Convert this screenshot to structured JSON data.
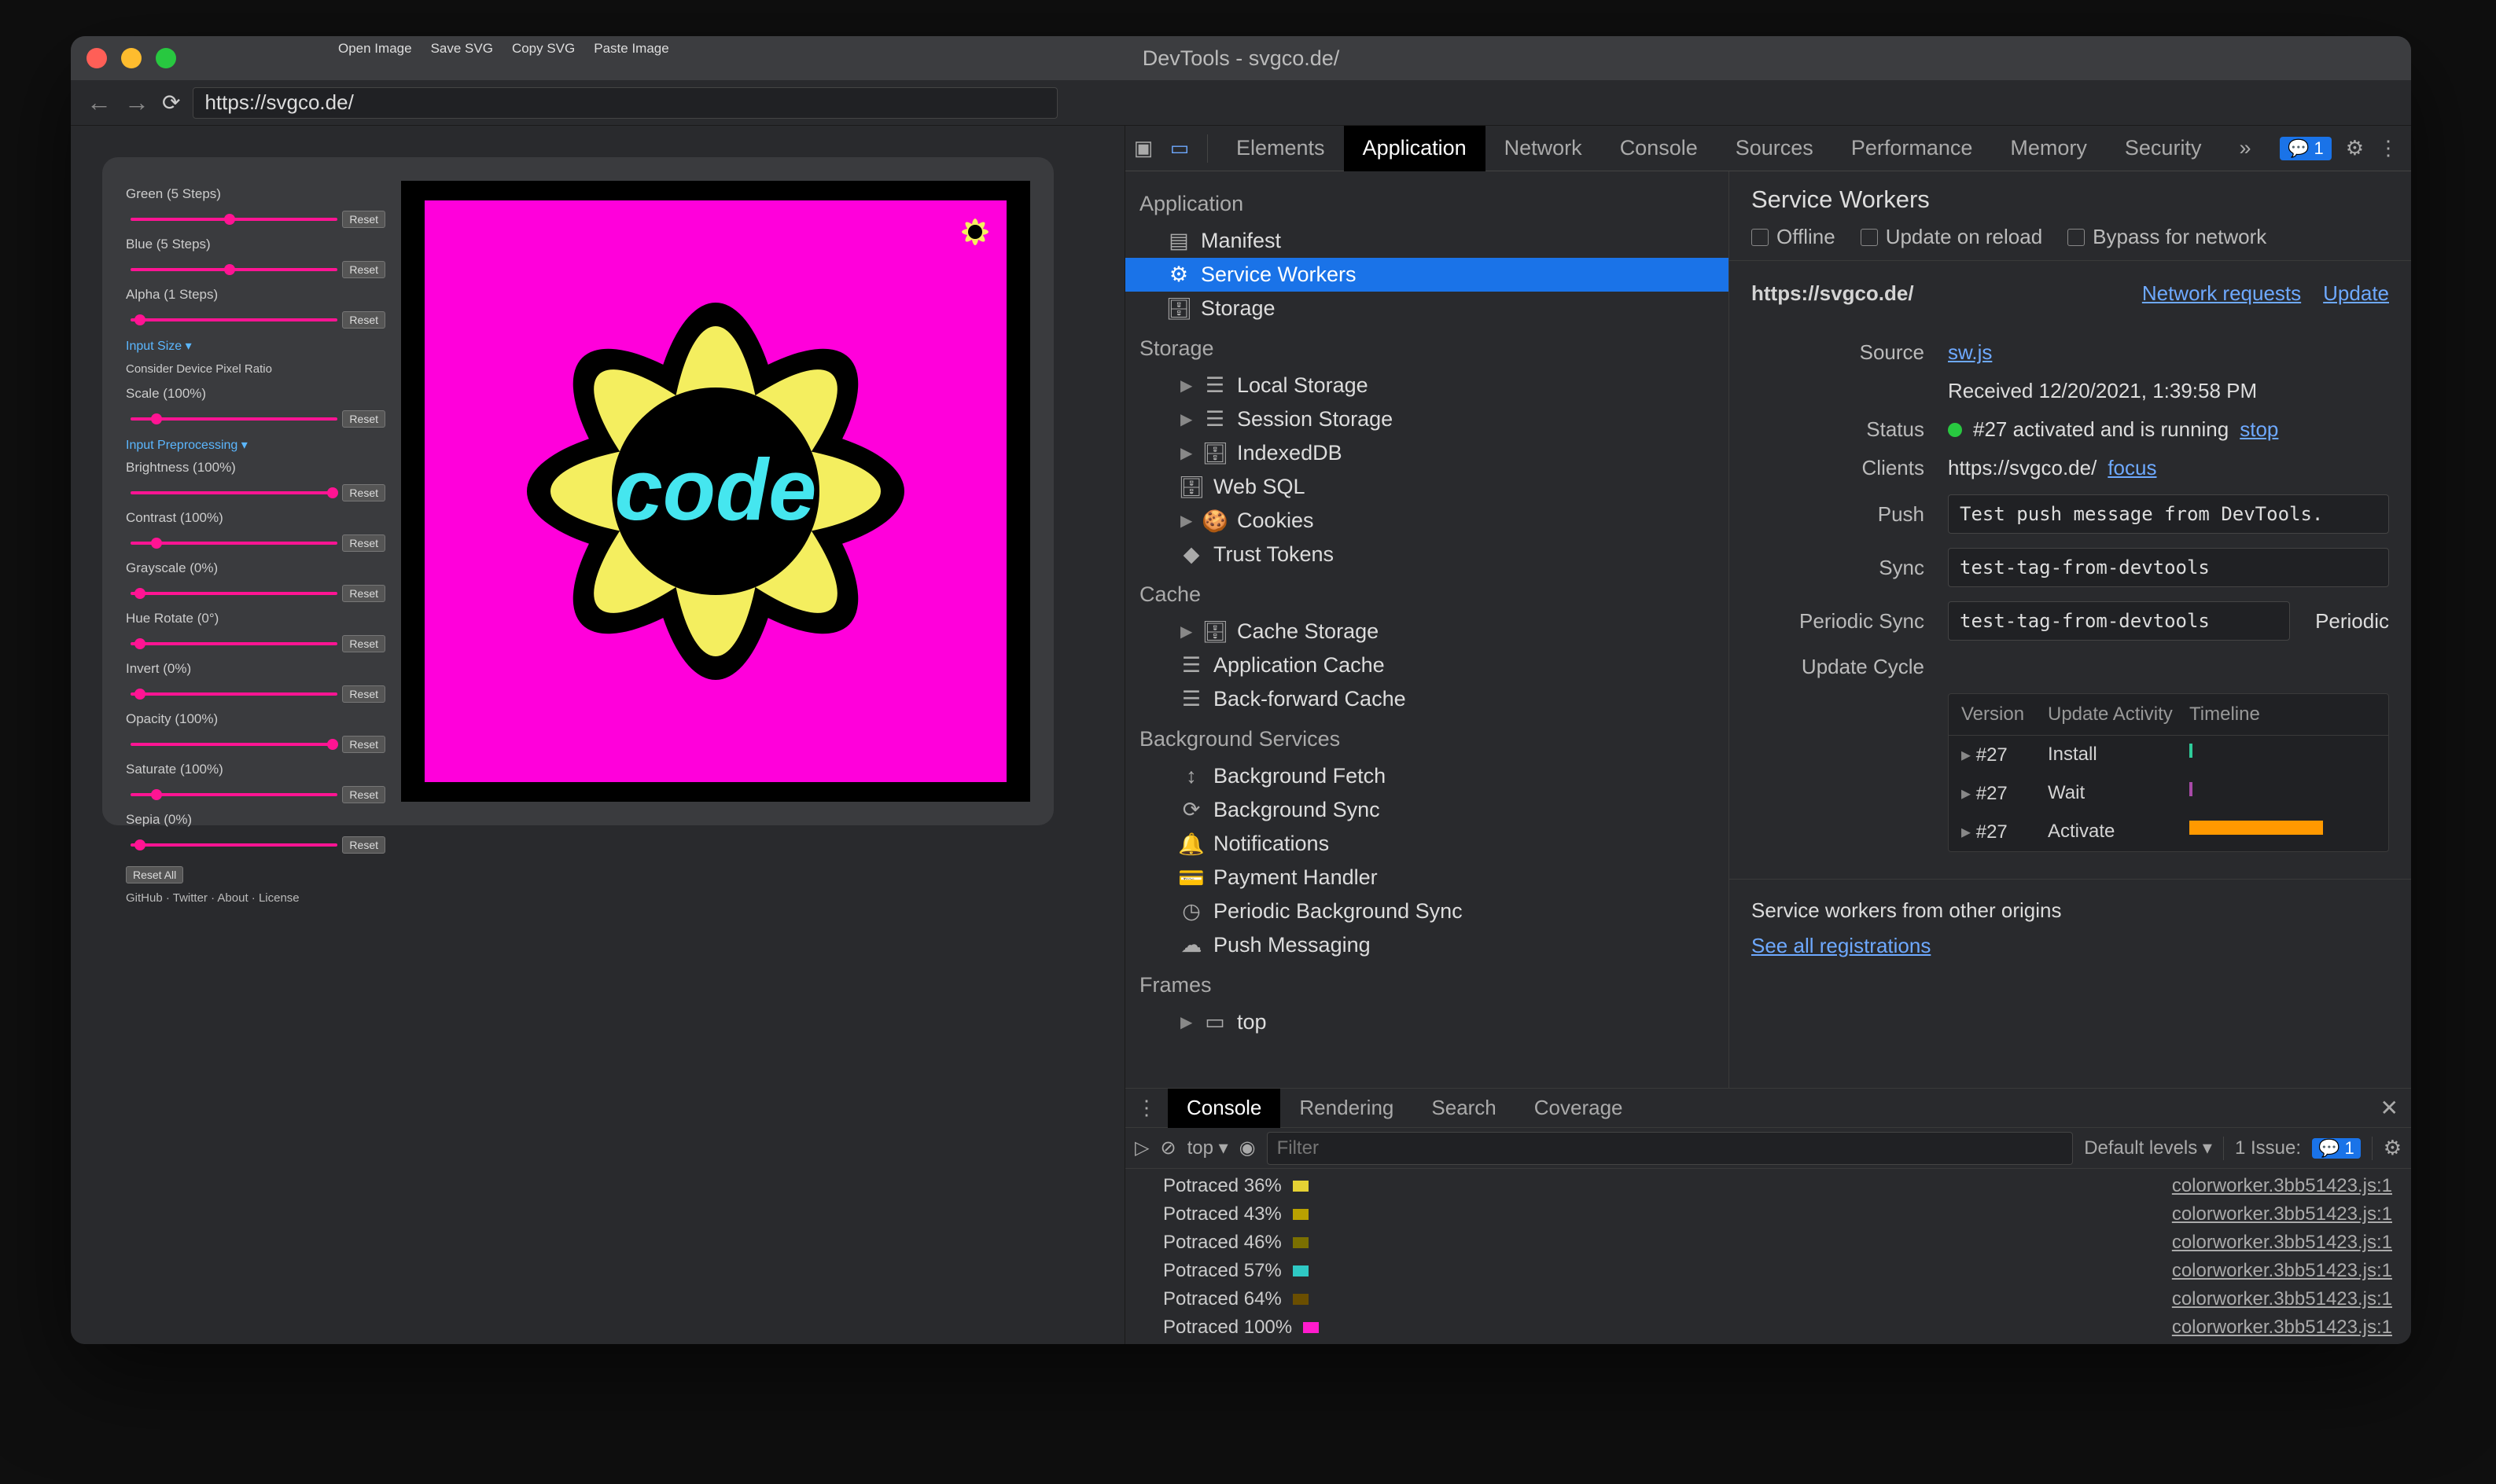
{
  "window": {
    "title": "DevTools - svgco.de/"
  },
  "browser": {
    "back": "←",
    "forward": "→",
    "reload": "⟳",
    "url": "https://svgco.de/"
  },
  "svgco": {
    "toolbar": [
      "Open Image",
      "Save SVG",
      "Copy SVG",
      "Paste Image"
    ],
    "sections": {
      "green": "Green (5 Steps)",
      "blue": "Blue (5 Steps)",
      "alpha": "Alpha (1 Steps)",
      "input_size": "Input Size ▾",
      "consider_pixel": "Consider Device Pixel Ratio",
      "scale": "Scale (100%)",
      "input_preproc": "Input Preprocessing ▾",
      "brightness": "Brightness (100%)",
      "contrast": "Contrast (100%)",
      "grayscale": "Grayscale (0%)",
      "hue": "Hue Rotate (0°)",
      "invert": "Invert (0%)",
      "opacity": "Opacity (100%)",
      "saturate": "Saturate (100%)",
      "sepia": "Sepia (0%)"
    },
    "reset": "Reset",
    "reset_all": "Reset All",
    "footer": "GitHub · Twitter · About · License"
  },
  "devtools": {
    "tabs": [
      "Elements",
      "Application",
      "Network",
      "Console",
      "Sources",
      "Performance",
      "Memory",
      "Security"
    ],
    "more": "»",
    "issues": "1",
    "tree": {
      "application": "Application",
      "manifest": "Manifest",
      "service_workers": "Service Workers",
      "storage_icon_label": "Storage",
      "storage": "Storage",
      "local_storage": "Local Storage",
      "session_storage": "Session Storage",
      "indexeddb": "IndexedDB",
      "web_sql": "Web SQL",
      "cookies": "Cookies",
      "trust_tokens": "Trust Tokens",
      "cache": "Cache",
      "cache_storage": "Cache Storage",
      "application_cache": "Application Cache",
      "bfcache": "Back-forward Cache",
      "bg_services": "Background Services",
      "bg_fetch": "Background Fetch",
      "bg_sync": "Background Sync",
      "notifications": "Notifications",
      "payment": "Payment Handler",
      "periodic_bg_sync": "Periodic Background Sync",
      "push": "Push Messaging",
      "frames": "Frames",
      "top": "top"
    },
    "sw": {
      "title": "Service Workers",
      "offline": "Offline",
      "update_reload": "Update on reload",
      "bypass": "Bypass for network",
      "origin": "https://svgco.de/",
      "network_requests": "Network requests",
      "update": "Update",
      "source_lbl": "Source",
      "source_val": "sw.js",
      "received": "Received 12/20/2021, 1:39:58 PM",
      "status_lbl": "Status",
      "status_val": "#27 activated and is running",
      "stop": "stop",
      "clients_lbl": "Clients",
      "clients_val": "https://svgco.de/",
      "focus": "focus",
      "push_lbl": "Push",
      "push_val": "Test push message from DevTools.",
      "sync_lbl": "Sync",
      "sync_val": "test-tag-from-devtools",
      "periodic_lbl": "Periodic Sync",
      "periodic_val": "test-tag-from-devtools",
      "periodic_btn": "Periodic",
      "update_cycle": "Update Cycle",
      "cycle_cols": [
        "Version",
        "Update Activity",
        "Timeline"
      ],
      "cycle_rows": [
        {
          "version": "#27",
          "activity": "Install",
          "color": "#2ecc9a"
        },
        {
          "version": "#27",
          "activity": "Wait",
          "color": "#a84aa8"
        },
        {
          "version": "#27",
          "activity": "Activate",
          "color": "#ff9900"
        }
      ],
      "other_origins": "Service workers from other origins",
      "see_all": "See all registrations"
    }
  },
  "drawer": {
    "tabs": [
      "Console",
      "Rendering",
      "Search",
      "Coverage"
    ],
    "context": "top ▾",
    "filter_ph": "Filter",
    "levels": "Default levels ▾",
    "issues": "1 Issue:",
    "issues_count": "1",
    "lines": [
      {
        "text": "Potraced 36%",
        "color": "#e5d134",
        "src": "colorworker.3bb51423.js:1"
      },
      {
        "text": "Potraced 43%",
        "color": "#b9a100",
        "src": "colorworker.3bb51423.js:1"
      },
      {
        "text": "Potraced 46%",
        "color": "#7a6f00",
        "src": "colorworker.3bb51423.js:1"
      },
      {
        "text": "Potraced 57%",
        "color": "#2fc9c4",
        "src": "colorworker.3bb51423.js:1"
      },
      {
        "text": "Potraced 64%",
        "color": "#6a4e00",
        "src": "colorworker.3bb51423.js:1"
      },
      {
        "text": "Potraced 100%",
        "color": "#ff1bcd",
        "src": "colorworker.3bb51423.js:1"
      }
    ],
    "prompt": ">"
  }
}
